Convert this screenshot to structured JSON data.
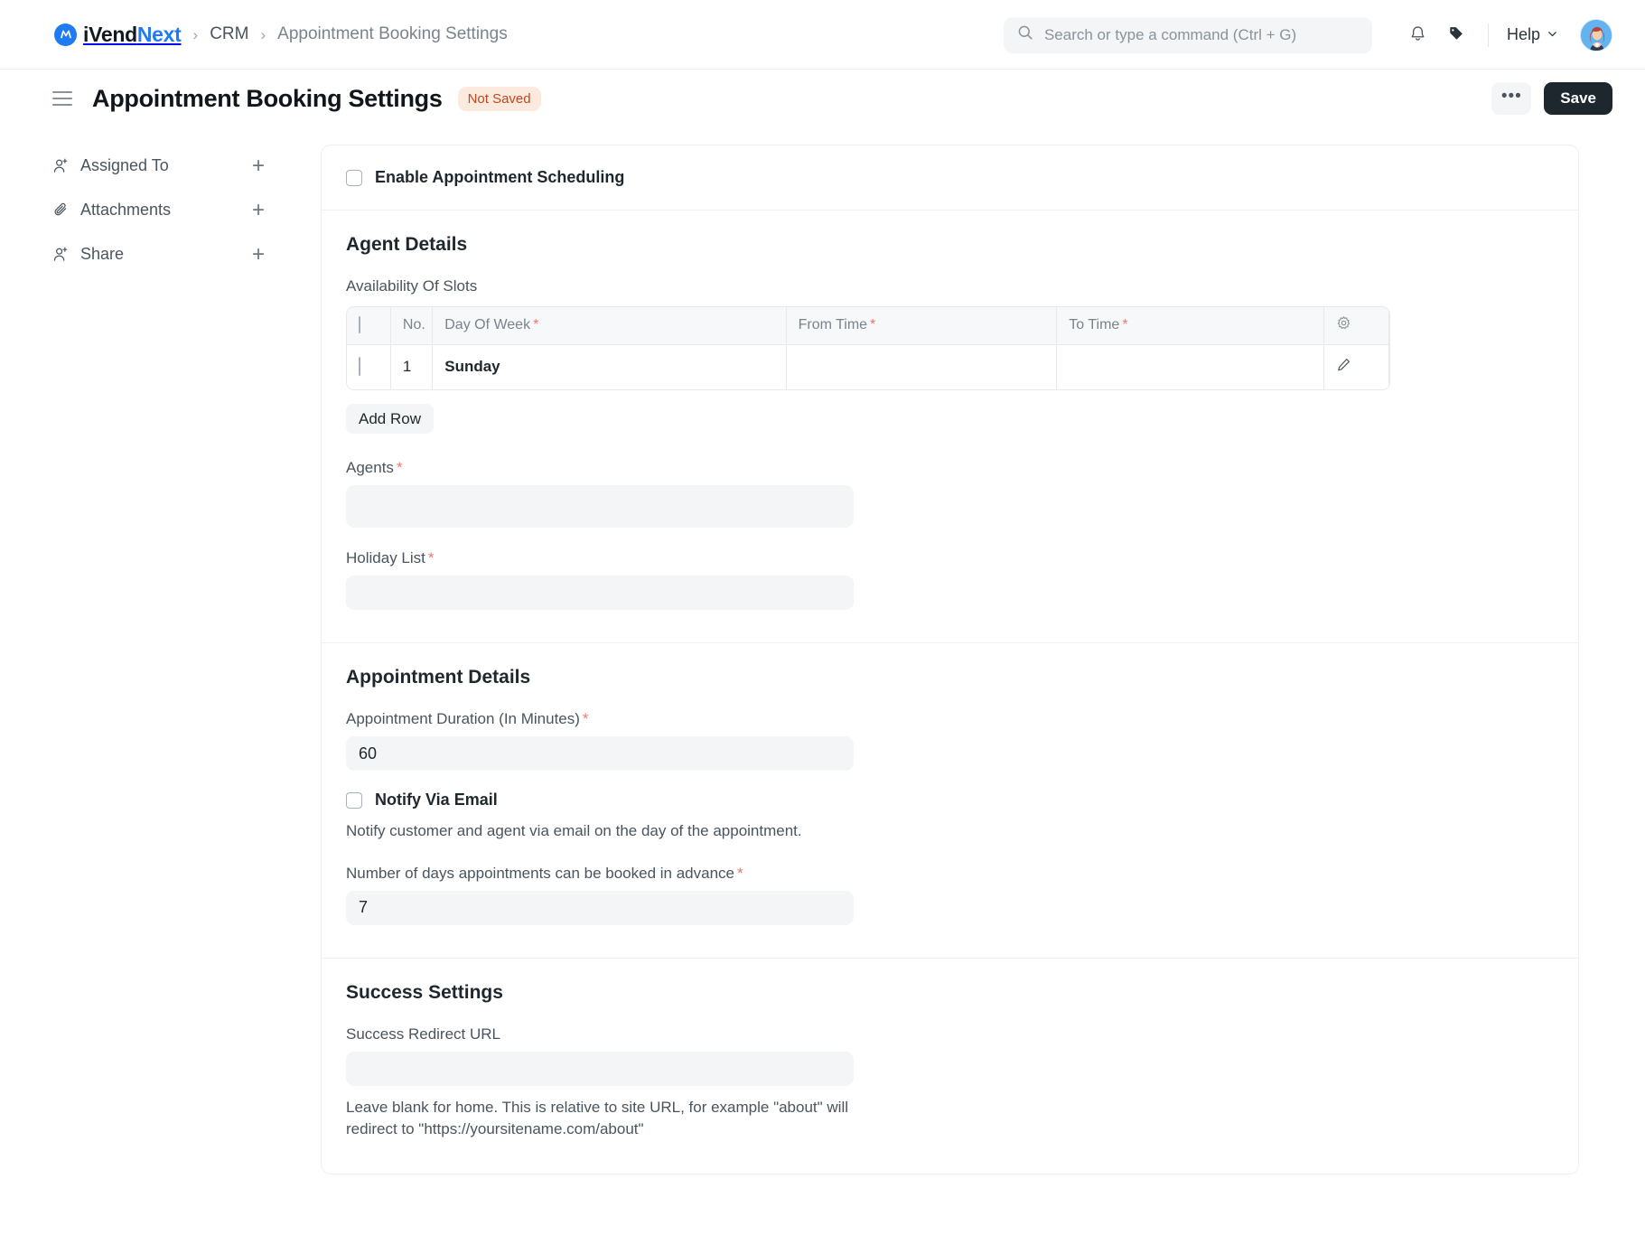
{
  "navbar": {
    "brand": {
      "part1": "iVend",
      "part2": "Next",
      "mark_icon": "ivendnext-logo-icon"
    },
    "breadcrumb": [
      {
        "label": "CRM",
        "current": false
      },
      {
        "label": "Appointment Booking Settings",
        "current": true
      }
    ],
    "separator": "›",
    "search": {
      "value": "",
      "placeholder": "Search or type a command (Ctrl + G)",
      "icon": "search-icon"
    },
    "notifications_icon": "bell-icon",
    "tag_icon": "tag-icon",
    "help_label": "Help",
    "help_chevron_icon": "chevron-down-icon",
    "avatar_icon": "user-avatar"
  },
  "page_head": {
    "menu_icon": "hamburger-menu-icon",
    "title": "Appointment Booking Settings",
    "status_badge": "Not Saved",
    "ellipsis_label": "•••",
    "save_label": "Save"
  },
  "sidebar": {
    "items": [
      {
        "label": "Assigned To",
        "icon": "user-add-icon",
        "action": "+"
      },
      {
        "label": "Attachments",
        "icon": "paperclip-icon",
        "action": "+"
      },
      {
        "label": "Share",
        "icon": "user-share-icon",
        "action": "+"
      }
    ]
  },
  "form": {
    "enable_scheduling": {
      "label": "Enable Appointment Scheduling",
      "checked": false
    },
    "agent_details": {
      "title": "Agent Details",
      "availability_label": "Availability Of Slots",
      "table": {
        "columns": [
          "No.",
          "Day Of Week",
          "From Time",
          "To Time"
        ],
        "required_columns": [
          "Day Of Week",
          "From Time",
          "To Time"
        ],
        "settings_icon": "gear-icon",
        "rows": [
          {
            "no": "1",
            "day_of_week": "Sunday",
            "from_time": "",
            "to_time": "",
            "edit_icon": "pencil-edit-icon",
            "checked": false
          }
        ]
      },
      "add_row_label": "Add Row",
      "agents": {
        "label": "Agents",
        "required": true,
        "value": ""
      },
      "holiday_list": {
        "label": "Holiday List",
        "required": true,
        "value": ""
      }
    },
    "appointment_details": {
      "title": "Appointment Details",
      "duration": {
        "label": "Appointment Duration (In Minutes)",
        "required": true,
        "value": "60"
      },
      "notify_via_email": {
        "label": "Notify Via Email",
        "checked": false,
        "description": "Notify customer and agent via email on the day of the appointment."
      },
      "advance_days": {
        "label": "Number of days appointments can be booked in advance",
        "required": true,
        "value": "7"
      }
    },
    "success_settings": {
      "title": "Success Settings",
      "redirect_url": {
        "label": "Success Redirect URL",
        "value": ""
      },
      "help_text": "Leave blank for home. This is relative to site URL, for example \"about\" will redirect to \"https://yoursitename.com/about\""
    }
  },
  "colors": {
    "brand_blue": "#1f7bf4",
    "badge_bg": "#fdeade",
    "badge_text": "#c0491c",
    "required_star": "#f0766b",
    "save_bg": "#1f272e",
    "input_bg": "#f4f5f6"
  }
}
